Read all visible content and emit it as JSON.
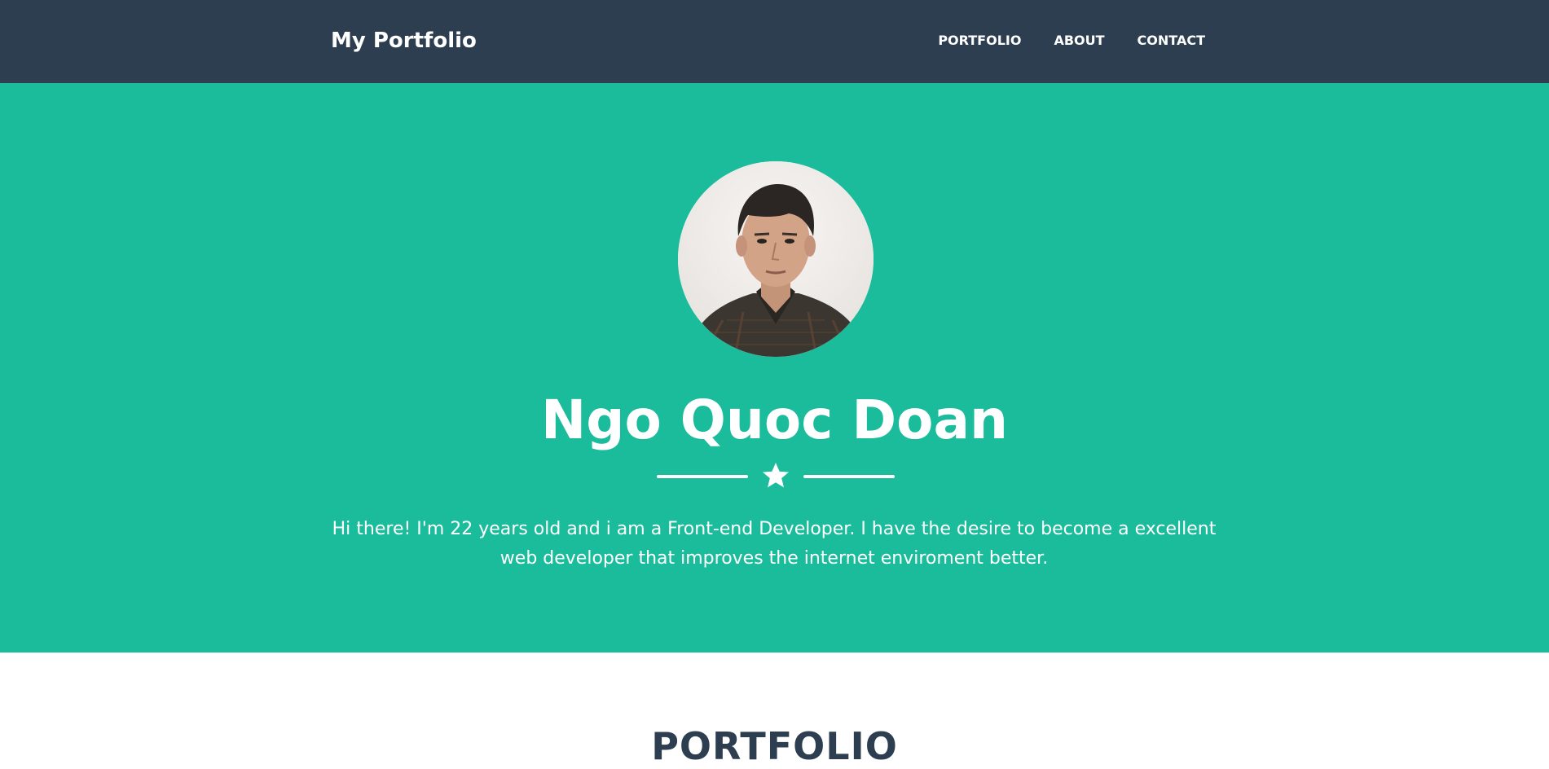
{
  "navbar": {
    "brand": "My Portfolio",
    "links": [
      "PORTFOLIO",
      "ABOUT",
      "CONTACT"
    ]
  },
  "hero": {
    "name": "Ngo Quoc Doan",
    "divider_icon": "star-icon",
    "intro": "Hi there! I'm 22 years old and i am a Front-end Developer. I have the desire to become a excellent web developer that improves the internet enviroment better."
  },
  "portfolio": {
    "title": "PORTFOLIO"
  },
  "colors": {
    "navbar": "#2c3e50",
    "hero": "#1abc9c",
    "text_light": "#ffffff",
    "title_dark": "#2c3e50"
  }
}
